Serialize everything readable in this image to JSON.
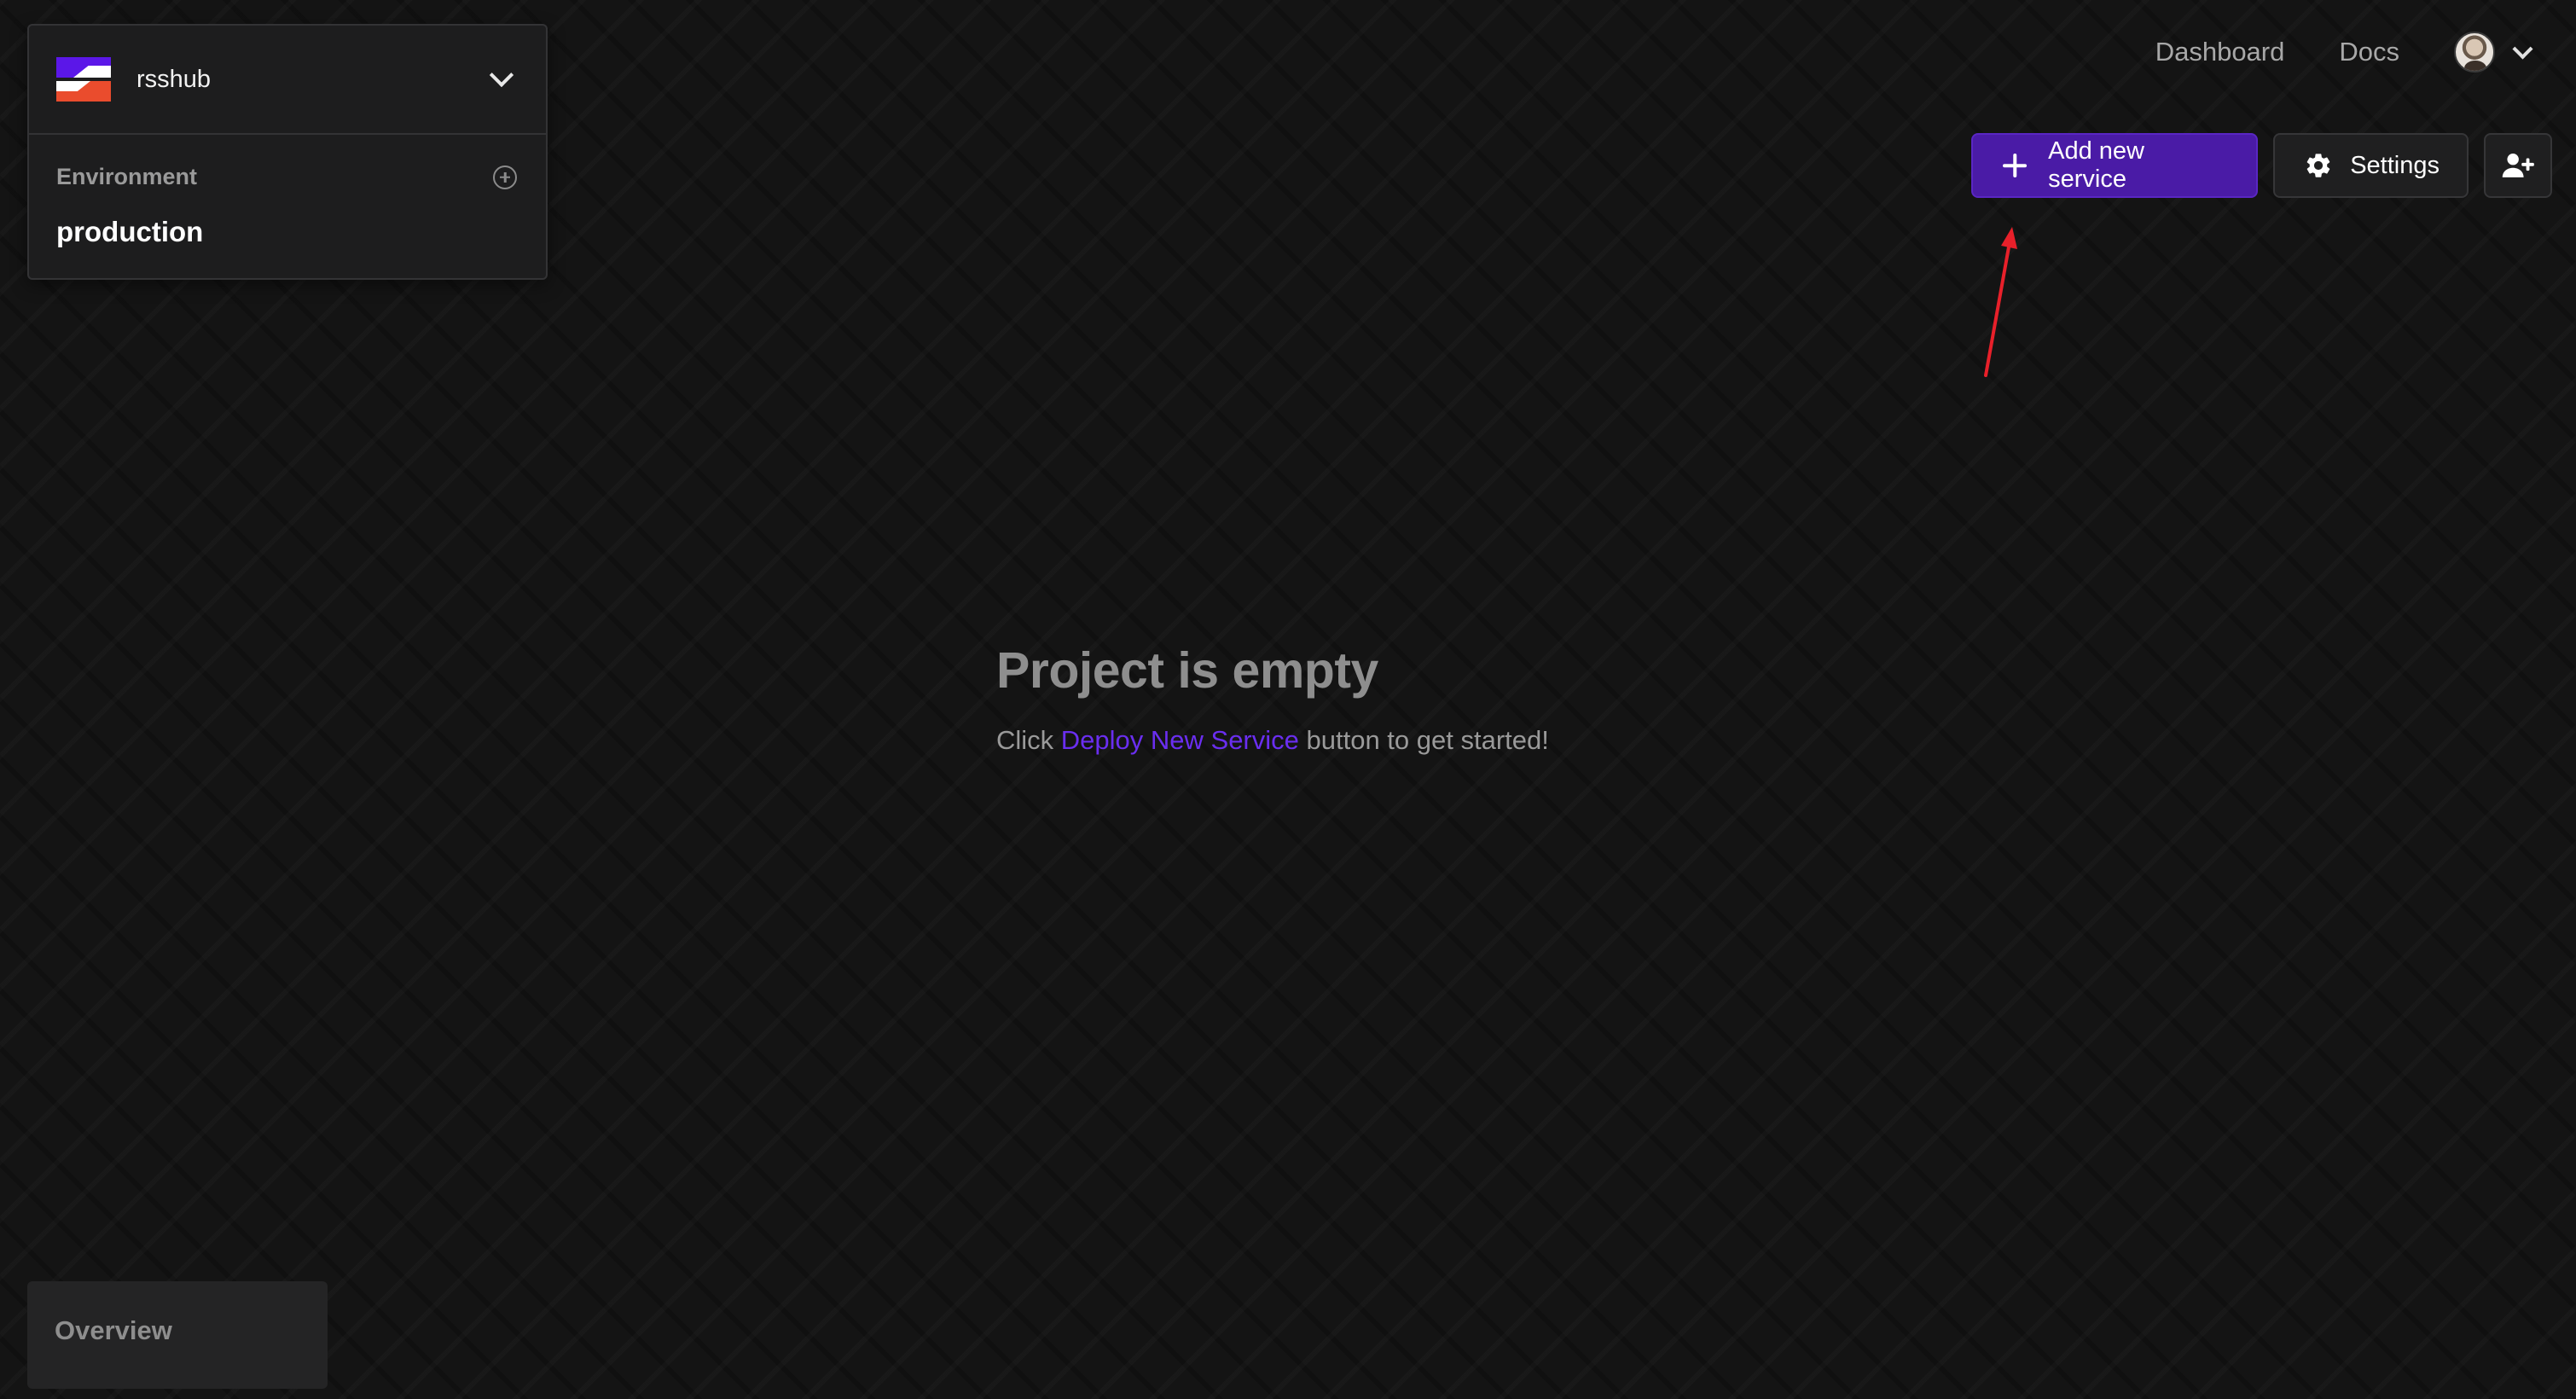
{
  "project": {
    "name": "rsshub",
    "logo_colors": [
      "#5b17e8",
      "#ffffff",
      "#ea4c2d"
    ]
  },
  "environment": {
    "label": "Environment",
    "current": "production"
  },
  "nav": {
    "dashboard": "Dashboard",
    "docs": "Docs"
  },
  "actions": {
    "add_service": "Add new service",
    "settings": "Settings"
  },
  "empty_state": {
    "title": "Project is empty",
    "subtitle_prefix": "Click ",
    "subtitle_link": "Deploy New Service",
    "subtitle_suffix": " button to get started!"
  },
  "sidebar": {
    "overview": "Overview"
  },
  "colors": {
    "accent": "#4a1ba6",
    "link": "#6a2ef0",
    "annotation": "#e8202a",
    "background": "#141414"
  },
  "icons": {
    "add_service": "plus-icon",
    "settings": "gear-icon",
    "invite": "user-add-icon",
    "add_environment": "plus-circle-icon"
  }
}
